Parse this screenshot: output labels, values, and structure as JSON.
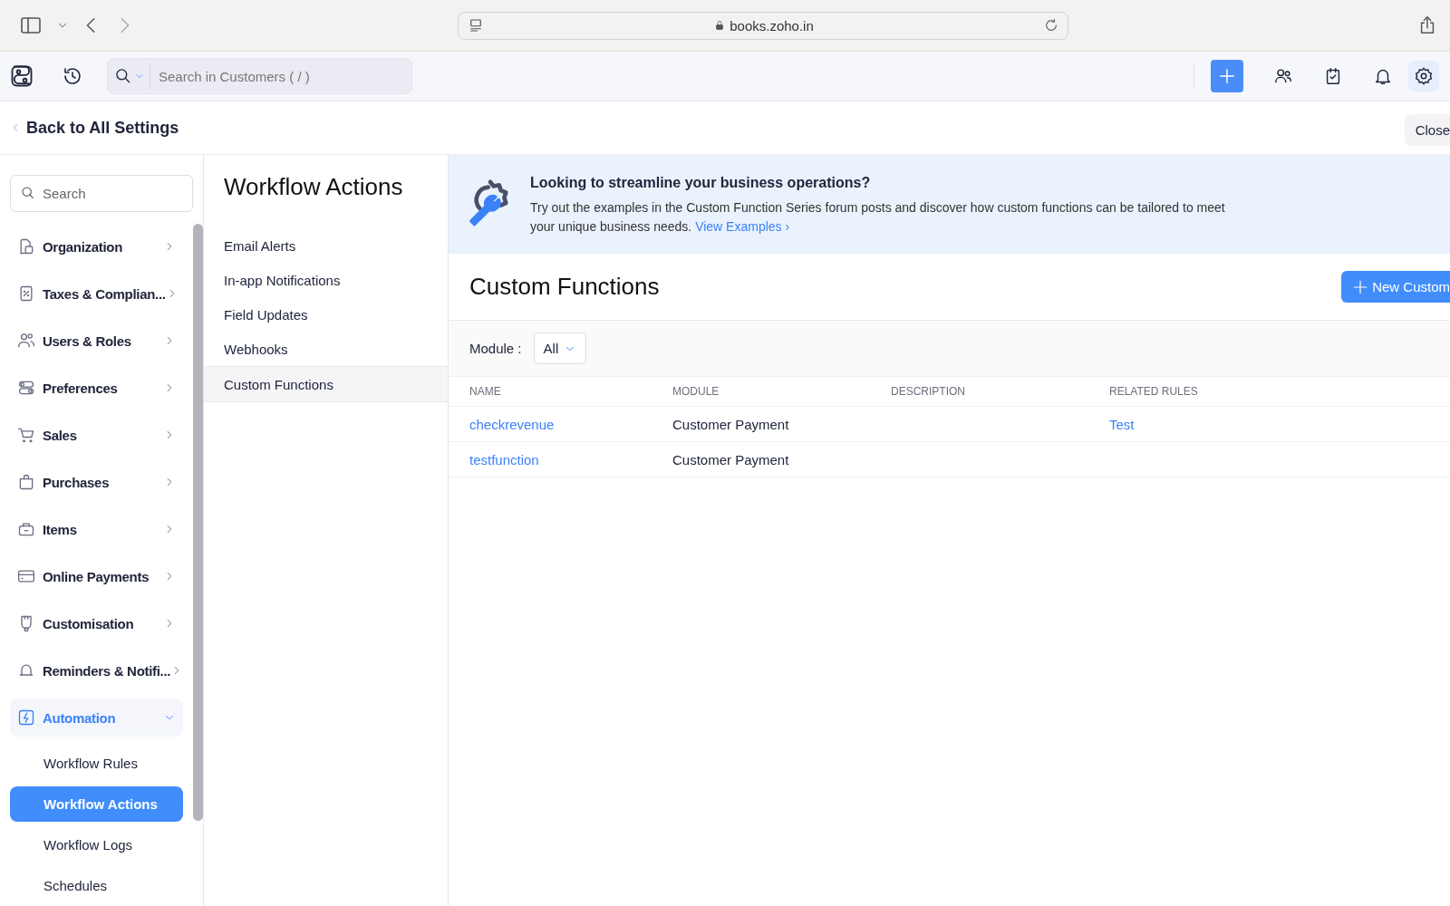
{
  "browser": {
    "url": "books.zoho.in"
  },
  "topbar": {
    "search": {
      "placeholder": "Search in Customers ( / )"
    }
  },
  "back_link": "Back to All Settings",
  "close_button": "Close",
  "sidebar": {
    "search": {
      "placeholder": "Search"
    },
    "items": [
      {
        "label": "Organization",
        "expanded": false,
        "selected": false
      },
      {
        "label": "Taxes & Complian...",
        "expanded": false,
        "selected": false
      },
      {
        "label": "Users & Roles",
        "expanded": false,
        "selected": false
      },
      {
        "label": "Preferences",
        "expanded": false,
        "selected": false
      },
      {
        "label": "Sales",
        "expanded": false,
        "selected": false
      },
      {
        "label": "Purchases",
        "expanded": false,
        "selected": false
      },
      {
        "label": "Items",
        "expanded": false,
        "selected": false
      },
      {
        "label": "Online Payments",
        "expanded": false,
        "selected": false
      },
      {
        "label": "Customisation",
        "expanded": false,
        "selected": false
      },
      {
        "label": "Reminders & Notifi...",
        "expanded": false,
        "selected": false
      },
      {
        "label": "Automation",
        "expanded": true,
        "selected": true,
        "children": [
          {
            "label": "Workflow Rules",
            "selected": false
          },
          {
            "label": "Workflow Actions",
            "selected": true
          },
          {
            "label": "Workflow Logs",
            "selected": false
          },
          {
            "label": "Schedules",
            "selected": false
          }
        ]
      }
    ]
  },
  "actions": {
    "title": "Workflow Actions",
    "items": [
      {
        "label": "Email Alerts",
        "selected": false
      },
      {
        "label": "In-app Notifications",
        "selected": false
      },
      {
        "label": "Field Updates",
        "selected": false
      },
      {
        "label": "Webhooks",
        "selected": false
      },
      {
        "label": "Custom Functions",
        "selected": true
      }
    ]
  },
  "banner": {
    "heading": "Looking to streamline your business operations?",
    "text": "Try out the examples in the Custom Function Series forum posts and discover how custom functions can be tailored to meet your unique business needs.",
    "link": "View Examples ›"
  },
  "functions": {
    "title": "Custom Functions",
    "new_button": "New Custom",
    "filter": {
      "label": "Module :",
      "value": "All"
    },
    "table": {
      "columns": [
        "NAME",
        "MODULE",
        "DESCRIPTION",
        "RELATED RULES"
      ],
      "rows": [
        {
          "name": "checkrevenue",
          "module": "Customer Payment",
          "related_rules": "Test"
        },
        {
          "name": "testfunction",
          "module": "Customer Payment"
        }
      ]
    }
  }
}
